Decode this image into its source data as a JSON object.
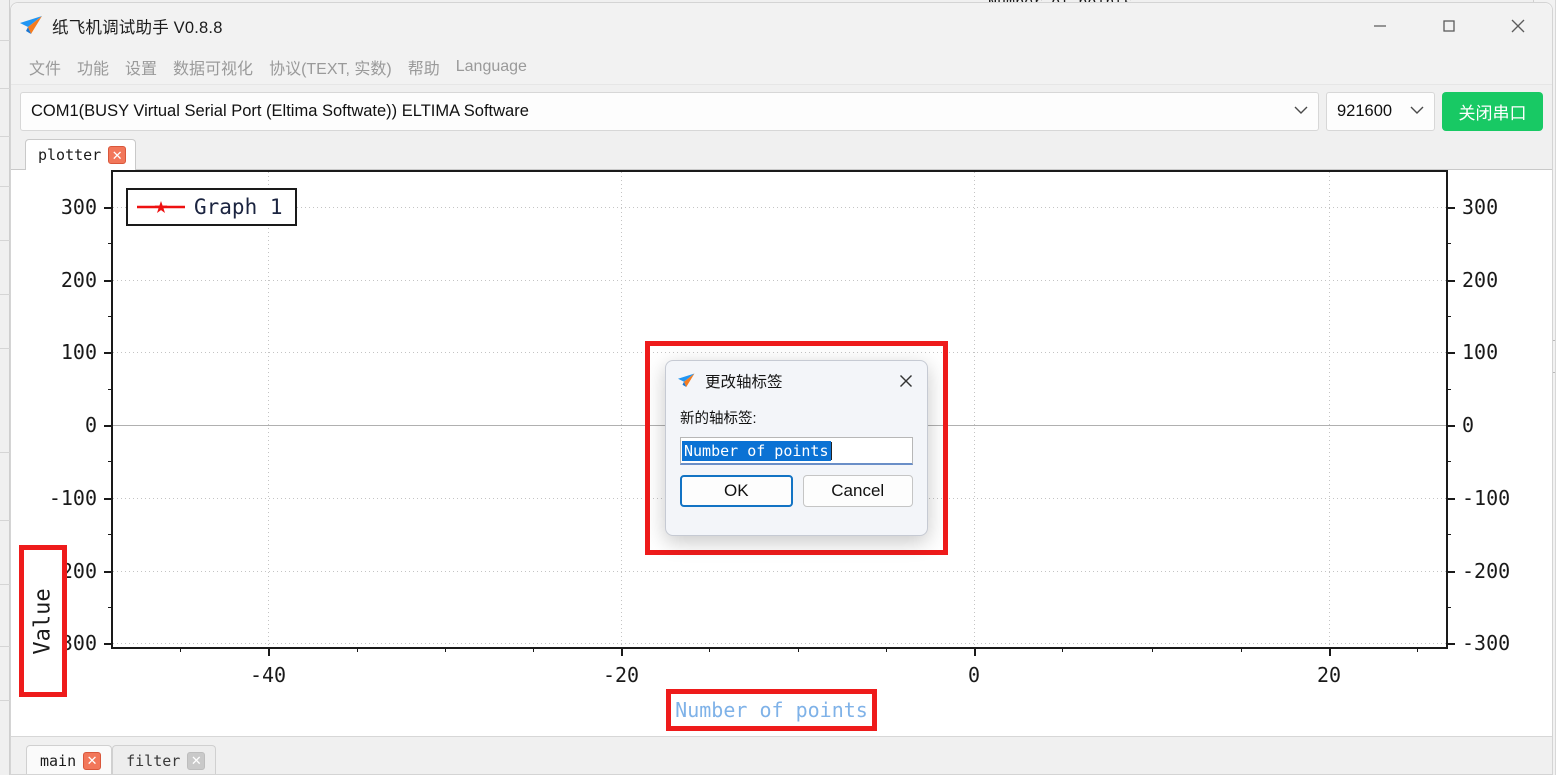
{
  "background": {
    "top_partial_label": "Number of points"
  },
  "window": {
    "title": "纸飞机调试助手 V0.8.8",
    "app_icon": "paper-plane-icon",
    "controls": {
      "minimize": "minimize-icon",
      "maximize": "maximize-icon",
      "close": "close-icon"
    }
  },
  "menubar": {
    "items": [
      {
        "label": "文件"
      },
      {
        "label": "功能"
      },
      {
        "label": "设置"
      },
      {
        "label": "数据可视化"
      },
      {
        "label": "协议(TEXT, 实数)"
      },
      {
        "label": "帮助"
      },
      {
        "label": "Language"
      }
    ]
  },
  "toolbar": {
    "com_port": "COM1(BUSY  Virtual Serial Port (Eltima Softwate)) ELTIMA Software",
    "baud_rate": "921600",
    "close_port_label": "关闭串口",
    "dropdown_icon": "chevron-down-icon"
  },
  "top_tabs": [
    {
      "label": "plotter",
      "active": true,
      "close_icon": "close-icon"
    }
  ],
  "bottom_tabs": [
    {
      "label": "main",
      "active": true,
      "close_icon": "close-icon"
    },
    {
      "label": "filter",
      "active": false,
      "close_icon": "close-icon"
    }
  ],
  "chart_data": {
    "type": "line",
    "title": "",
    "xlabel": "Number of points",
    "ylabel": "Value",
    "xlim": [
      -52,
      28
    ],
    "ylim": [
      -330,
      330
    ],
    "xticks": [
      -40,
      -20,
      0,
      20
    ],
    "xtick_labels": [
      "-40",
      "-20",
      "0",
      "20"
    ],
    "yticks": [
      -300,
      -200,
      -100,
      0,
      100,
      200,
      300
    ],
    "ytick_labels": [
      "-300",
      "-200",
      "-100",
      "0",
      "100",
      "200",
      "300"
    ],
    "right_axis_ticks": [
      -300,
      -200,
      -100,
      0,
      100,
      200,
      300
    ],
    "right_axis_tick_labels": [
      "-300",
      "-200",
      "-100",
      "0",
      "100",
      "200",
      "300"
    ],
    "grid": true,
    "legend_position": "upper left",
    "series": [
      {
        "name": "Graph 1",
        "color": "#ee1111",
        "marker": "star",
        "x": [],
        "y": []
      }
    ],
    "annotations": {
      "ylabel_highlight_color": "#ee1b1b",
      "xlabel_highlight_color": "#ee1b1b",
      "xlabel_text_color": "#7fb2e8"
    }
  },
  "dialog": {
    "icon": "paper-plane-icon",
    "title": "更改轴标签",
    "close_icon": "close-icon",
    "prompt": "新的轴标签:",
    "input_value": "Number of points",
    "input_selected": true,
    "ok_label": "OK",
    "cancel_label": "Cancel",
    "highlight_color": "#ee1b1b",
    "selection_color": "#0b72d4"
  }
}
